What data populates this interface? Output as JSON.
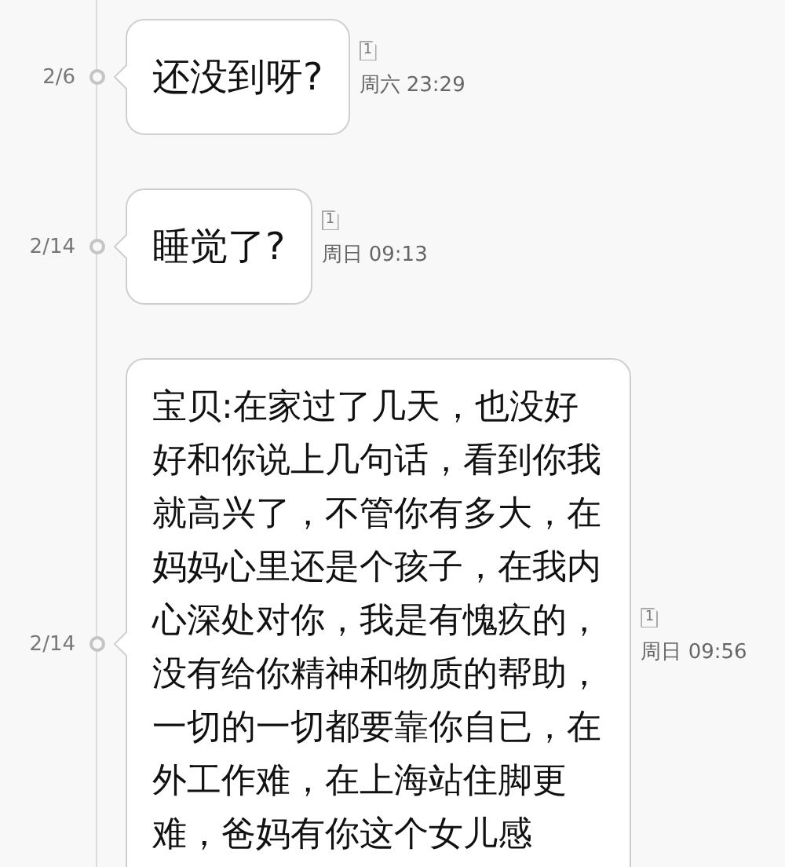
{
  "messages": [
    {
      "date": "2/6",
      "text": "还没到呀?",
      "sim": "1",
      "time": "周六 23:29"
    },
    {
      "date": "2/14",
      "text": "睡觉了?",
      "sim": "1",
      "time": "周日 09:13"
    },
    {
      "date": "2/14",
      "text": "宝贝:在家过了几天，也没好好和你说上几句话，看到你我就高兴了，不管你有多大，在妈妈心里还是个孩子，在我内心深处对你，我是有愧疚的，没有给你精神和物质的帮助，一切的一切都要靠你自已，在外工作难，在上海站住脚更难，爸妈有你这个女儿感",
      "sim": "1",
      "time": "周日 09:56"
    }
  ]
}
